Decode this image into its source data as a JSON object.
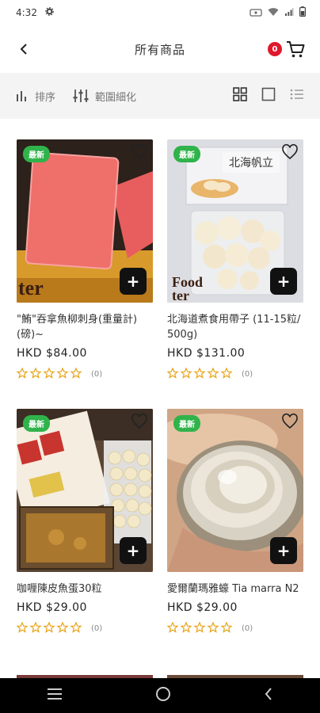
{
  "status": {
    "time": "4:32"
  },
  "header": {
    "title": "所有商品",
    "cart_count": "0"
  },
  "filters": {
    "sort_label": "排序",
    "refine_label": "範圍細化"
  },
  "products": [
    {
      "name": "\"鮪\"吞拿魚柳刺身(重量計)(磅)~",
      "price": "HKD $84.00",
      "reviews": "(0)",
      "badge": "最新"
    },
    {
      "name": "北海道煮食用帶子 (11-15粒/ 500g)",
      "price": "HKD $131.00",
      "reviews": "(0)",
      "badge": "最新"
    },
    {
      "name": "咖喱陳皮魚蛋30粒",
      "price": "HKD $29.00",
      "reviews": "(0)",
      "badge": "最新"
    },
    {
      "name": "愛爾蘭瑪雅蠔 Tia marra N2",
      "price": "HKD $29.00",
      "reviews": "(0)",
      "badge": "最新"
    }
  ],
  "colors": {
    "accent": "#e0182d",
    "badge": "#2fb34a",
    "star": "#e8a317"
  }
}
